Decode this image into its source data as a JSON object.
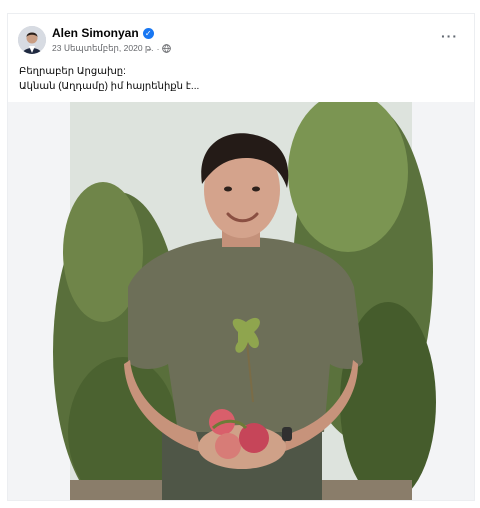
{
  "post": {
    "author": "Alen Simonyan",
    "date": "23 Սեպտեմբեր, 2020 թ.",
    "separator": "·",
    "privacy_icon": "globe-icon",
    "more_icon": "ellipsis-icon",
    "text_line_1": "Բեղրաբեր Արցախը:",
    "text_line_2": "Ակնան (Աղդամը) իմ հայրենիքն է..."
  },
  "colors": {
    "verified": "#1877f2",
    "meta_text": "#65676b",
    "shirt": "#6d6f58"
  }
}
